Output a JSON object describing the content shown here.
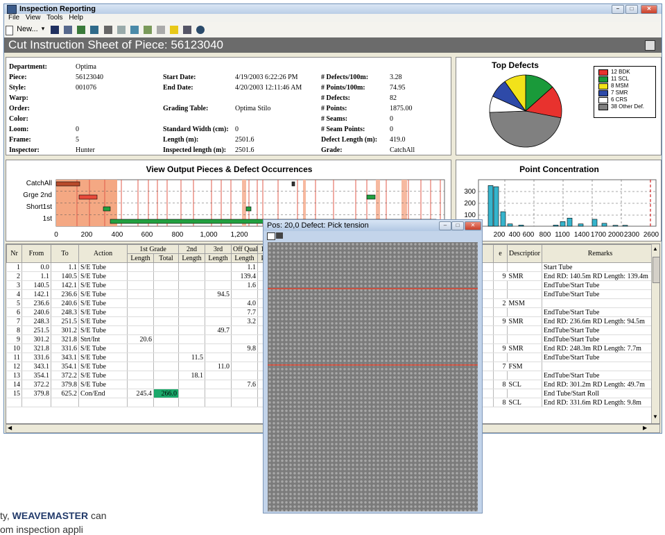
{
  "window": {
    "title": "Inspection Reporting"
  },
  "menu": [
    "File",
    "View",
    "Tools",
    "Help"
  ],
  "toolbar": {
    "new_label": "New..."
  },
  "sheet_title": "Cut Instruction Sheet of Piece: 56123040",
  "info": {
    "col1": [
      {
        "label": "Department:",
        "value": "Optima"
      },
      {
        "label": "Piece:",
        "value": "56123040"
      },
      {
        "label": "Style:",
        "value": "001076"
      },
      {
        "label": "Warp:",
        "value": ""
      },
      {
        "label": "Order:",
        "value": ""
      },
      {
        "label": "Color:",
        "value": ""
      },
      {
        "label": "Loom:",
        "value": "0"
      },
      {
        "label": "Frame:",
        "value": "5"
      },
      {
        "label": "Inspector:",
        "value": "Hunter"
      }
    ],
    "col2": [
      {
        "label": "",
        "value": ""
      },
      {
        "label": "Start Date:",
        "value": "4/19/2003 6:22:26 PM"
      },
      {
        "label": "End Date:",
        "value": "4/20/2003 12:11:46 AM"
      },
      {
        "label": "",
        "value": ""
      },
      {
        "label": "Grading Table:",
        "value": "Optima Stilo"
      },
      {
        "label": "",
        "value": ""
      },
      {
        "label": "Standard Width (cm):",
        "value": "0"
      },
      {
        "label": "Length (m):",
        "value": "2501.6"
      },
      {
        "label": "Inspected length (m):",
        "value": "2501.6"
      }
    ],
    "col3": [
      {
        "label": "",
        "value": ""
      },
      {
        "label": "# Defects/100m:",
        "value": "3.28"
      },
      {
        "label": "# Points/100m:",
        "value": "74.95"
      },
      {
        "label": "# Defects:",
        "value": "82"
      },
      {
        "label": "# Points:",
        "value": "1875.00"
      },
      {
        "label": "# Seams:",
        "value": "0"
      },
      {
        "label": "# Seam Points:",
        "value": "0"
      },
      {
        "label": "Defect Length (m):",
        "value": "419.0"
      },
      {
        "label": "Grade:",
        "value": "CatchAll"
      }
    ]
  },
  "top_defects": {
    "title": "Top Defects",
    "legend": [
      {
        "label": "12 BDK",
        "color": "#e8322e",
        "value": 12
      },
      {
        "label": "11 SCL",
        "color": "#1a9a3a",
        "value": 11
      },
      {
        "label": "8 MSM",
        "color": "#f2e21a",
        "value": 8
      },
      {
        "label": "7 SMR",
        "color": "#2e4aa8",
        "value": 7
      },
      {
        "label": "6 CRS",
        "color": "#ffffff",
        "value": 6
      },
      {
        "label": "38 Other Def.",
        "color": "#808080",
        "value": 38
      }
    ]
  },
  "occurrences": {
    "title": "View Output Pieces & Defect Occurrences",
    "rows": [
      "CatchAll",
      "Grge 2nd",
      "Short1st",
      "1st"
    ],
    "ticks": [
      "0",
      "200",
      "400",
      "600",
      "800",
      "1,000",
      "1,200",
      "1"
    ]
  },
  "point_concentration": {
    "title": "Point Concentration",
    "yticks": [
      "300",
      "200",
      "100"
    ],
    "xticks": [
      "200",
      "400",
      "600",
      "800",
      "1100",
      "1400",
      "1700",
      "2000",
      "2300",
      "2600"
    ]
  },
  "table": {
    "group_headers": [
      "1st Grade",
      "2nd",
      "3rd",
      "Off Qual",
      "1st G"
    ],
    "headers": [
      "Nr",
      "From",
      "To",
      "Action",
      "Length",
      "Total",
      "Length",
      "Length",
      "Length",
      "Pnts/"
    ],
    "right_headers": [
      "e",
      "Descriptior",
      "Remarks"
    ],
    "rows": [
      {
        "nr": "1",
        "from": "0.0",
        "to": "1.1",
        "action": "S/E Tube",
        "l1": "",
        "tot": "",
        "l2": "",
        "l3": "",
        "loq": "1.1",
        "rc": "",
        "desc": "",
        "rem": "Start Tube"
      },
      {
        "nr": "2",
        "from": "1.1",
        "to": "140.5",
        "action": "S/E Tube",
        "l1": "",
        "tot": "",
        "l2": "",
        "l3": "",
        "loq": "139.4",
        "rc": "9",
        "desc": "SMR",
        "rem": "End RD: 140.5m  RD Length: 139.4m"
      },
      {
        "nr": "3",
        "from": "140.5",
        "to": "142.1",
        "action": "S/E Tube",
        "l1": "",
        "tot": "",
        "l2": "",
        "l3": "",
        "loq": "1.6",
        "rc": "",
        "desc": "",
        "rem": "EndTube/Start Tube"
      },
      {
        "nr": "4",
        "from": "142.1",
        "to": "236.6",
        "action": "S/E Tube",
        "l1": "",
        "tot": "",
        "l2": "",
        "l3": "94.5",
        "loq": "",
        "rc": "",
        "desc": "",
        "rem": "EndTube/Start Tube"
      },
      {
        "nr": "5",
        "from": "236.6",
        "to": "240.6",
        "action": "S/E Tube",
        "l1": "",
        "tot": "",
        "l2": "",
        "l3": "",
        "loq": "4.0",
        "rc": "2",
        "desc": "MSM",
        "rem": ""
      },
      {
        "nr": "6",
        "from": "240.6",
        "to": "248.3",
        "action": "S/E Tube",
        "l1": "",
        "tot": "",
        "l2": "",
        "l3": "",
        "loq": "7.7",
        "rc": "",
        "desc": "",
        "rem": "EndTube/Start Tube"
      },
      {
        "nr": "7",
        "from": "248.3",
        "to": "251.5",
        "action": "S/E Tube",
        "l1": "",
        "tot": "",
        "l2": "",
        "l3": "",
        "loq": "3.2",
        "rc": "9",
        "desc": "SMR",
        "rem": "End RD: 236.6m  RD Length: 94.5m"
      },
      {
        "nr": "8",
        "from": "251.5",
        "to": "301.2",
        "action": "S/E Tube",
        "l1": "",
        "tot": "",
        "l2": "",
        "l3": "49.7",
        "loq": "",
        "rc": "",
        "desc": "",
        "rem": "EndTube/Start Tube"
      },
      {
        "nr": "9",
        "from": "301.2",
        "to": "321.8",
        "action": "Strt/Int",
        "l1": "20.6",
        "tot": "",
        "l2": "",
        "l3": "",
        "loq": "",
        "rc": "",
        "desc": "",
        "rem": "EndTube/Start Tube"
      },
      {
        "nr": "10",
        "from": "321.8",
        "to": "331.6",
        "action": "S/E Tube",
        "l1": "",
        "tot": "",
        "l2": "",
        "l3": "",
        "loq": "9.8",
        "rc": "9",
        "desc": "SMR",
        "rem": "End RD: 248.3m  RD Length: 7.7m"
      },
      {
        "nr": "11",
        "from": "331.6",
        "to": "343.1",
        "action": "S/E Tube",
        "l1": "",
        "tot": "",
        "l2": "11.5",
        "l3": "",
        "loq": "",
        "rc": "",
        "desc": "",
        "rem": "EndTube/Start Tube"
      },
      {
        "nr": "12",
        "from": "343.1",
        "to": "354.1",
        "action": "S/E Tube",
        "l1": "",
        "tot": "",
        "l2": "",
        "l3": "11.0",
        "loq": "",
        "rc": "7",
        "desc": "FSM",
        "rem": ""
      },
      {
        "nr": "13",
        "from": "354.1",
        "to": "372.2",
        "action": "S/E Tube",
        "l1": "",
        "tot": "",
        "l2": "18.1",
        "l3": "",
        "loq": "",
        "rc": "",
        "desc": "",
        "rem": "EndTube/Start Tube"
      },
      {
        "nr": "14",
        "from": "372.2",
        "to": "379.8",
        "action": "S/E Tube",
        "l1": "",
        "tot": "",
        "l2": "",
        "l3": "",
        "loq": "7.6",
        "rc": "8",
        "desc": "SCL",
        "rem": "End RD: 301.2m  RD Length: 49.7m"
      },
      {
        "nr": "15",
        "from": "379.8",
        "to": "625.2",
        "action": "Con/End",
        "l1": "245.4",
        "tot": "266.0",
        "l2": "",
        "l3": "",
        "loq": "",
        "rc": "",
        "desc": "",
        "rem": "End Tube/Start Roll"
      },
      {
        "nr": "",
        "from": "",
        "to": "",
        "action": "",
        "l1": "",
        "tot": "",
        "l2": "",
        "l3": "",
        "loq": "",
        "rc": "8",
        "desc": "SCL",
        "rem": "End RD: 331.6m  RD Length: 9.8m"
      }
    ]
  },
  "popup": {
    "title": "Pos: 20,0 Defect: Pick tension"
  },
  "footer_text": {
    "prefix": "ty, ",
    "brand": "WEAVEMASTER",
    "suffix": " can",
    "line2": "om inspection appli"
  }
}
